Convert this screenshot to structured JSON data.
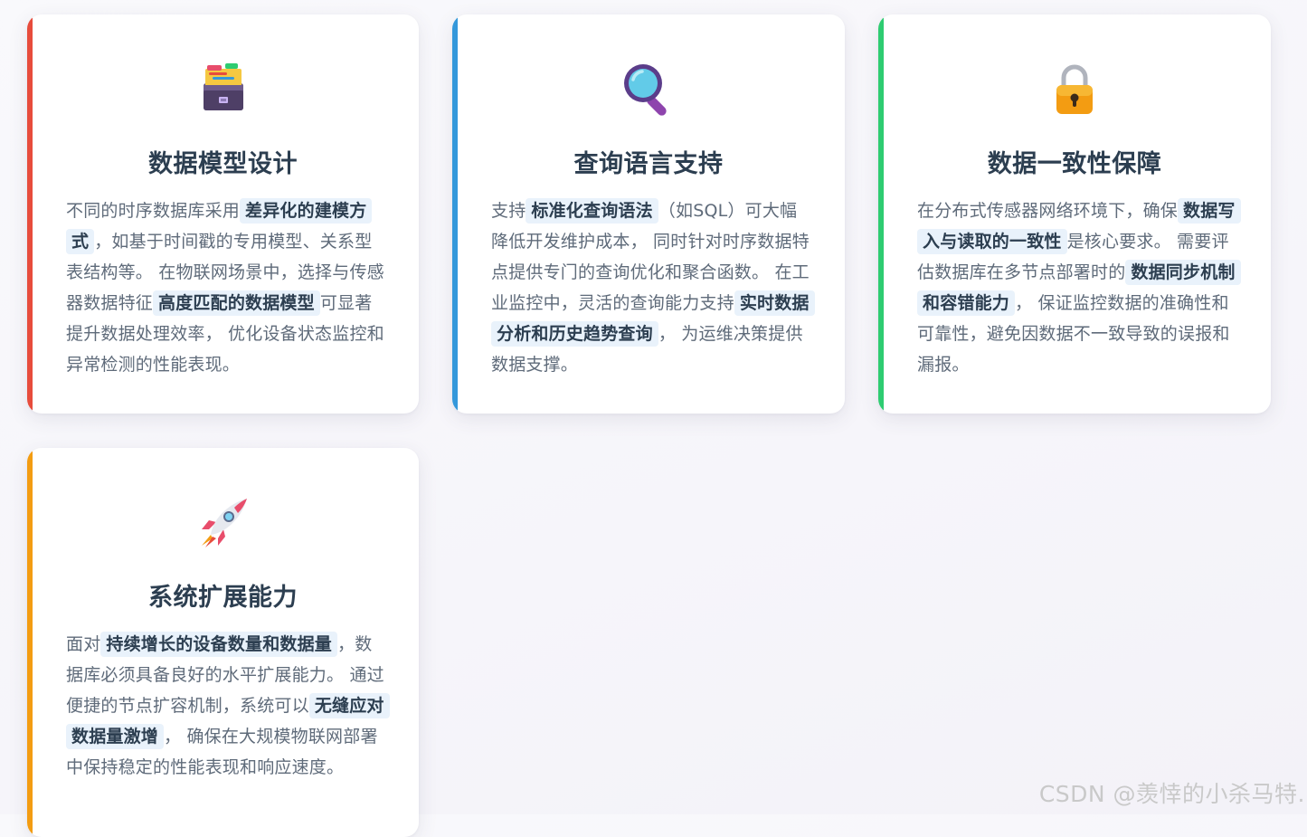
{
  "cards": [
    {
      "icon": "card-file-box-icon",
      "accent": "#e74c3c",
      "title": "数据模型设计",
      "text": {
        "t1": "不同的时序数据库采用",
        "h1": "差异化的建模方式",
        "t2": "，如基于时间戳的专用模型、关系型表结构等。 在物联网场景中，选择与传感器数据特征",
        "h2": "高度匹配的数据模型",
        "t3": "可显著提升数据处理效率， 优化设备状态监控和异常检测的性能表现。"
      }
    },
    {
      "icon": "magnifying-glass-icon",
      "accent": "#3498db",
      "title": "查询语言支持",
      "text": {
        "t1": "支持",
        "h1": "标准化查询语法",
        "t2": "（如SQL）可大幅降低开发维护成本， 同时针对时序数据特点提供专门的查询优化和聚合函数。 在工业监控中，灵活的查询能力支持",
        "h2": "实时数据分析和历史趋势查询",
        "t3": "， 为运维决策提供数据支撑。"
      }
    },
    {
      "icon": "lock-icon",
      "accent": "#2ecc71",
      "title": "数据一致性保障",
      "text": {
        "t1": "在分布式传感器网络环境下，确保",
        "h1": "数据写入与读取的一致性",
        "t2": "是核心要求。 需要评估数据库在多节点部署时的",
        "h2": "数据同步机制和容错能力",
        "t3": "， 保证监控数据的准确性和可靠性，避免因数据不一致导致的误报和漏报。"
      }
    },
    {
      "icon": "rocket-icon",
      "accent": "#f39c12",
      "title": "系统扩展能力",
      "text": {
        "t1": "面对",
        "h1": "持续增长的设备数量和数据量",
        "t2": "，数据库必须具备良好的水平扩展能力。 通过便捷的节点扩容机制，系统可以",
        "h2": "无缝应对数据量激增",
        "t3": "， 确保在大规模物联网部署中保持稳定的性能表现和响应速度。"
      }
    }
  ],
  "watermark": "CSDN @羡悻的小杀马特."
}
